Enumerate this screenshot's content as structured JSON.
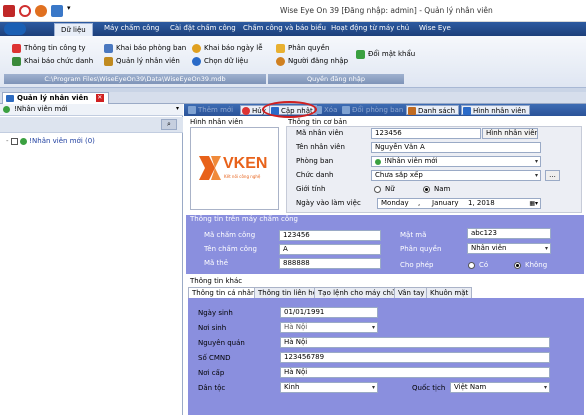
{
  "window": {
    "title": "Wise Eye On 39 [Đăng nhập: admin] - Quản lý nhân viên"
  },
  "menu": [
    {
      "label": "Dữ liệu",
      "active": true
    },
    {
      "label": "Máy chấm công"
    },
    {
      "label": "Cài đặt chấm công"
    },
    {
      "label": "Chấm công và báo biểu"
    },
    {
      "label": "Hoạt động từ máy chủ"
    },
    {
      "label": "Wise Eye"
    }
  ],
  "ribbon": {
    "company_info": "Thông tin công ty",
    "department": "Khai báo phòng ban",
    "holiday": "Khai báo ngày lễ",
    "position": "Khai báo chức danh",
    "staff": "Quản lý nhân viên",
    "select_data": "Chọn dữ liệu",
    "permission": "Phân quyền",
    "login_user": "Người đăng nhập",
    "change_password": "Đổi mật khẩu",
    "path_group": "C:\\Program Files\\WiseEyeOn39\\Data\\WiseEyeOn39.mdb",
    "login_group": "Quyền đăng nhập"
  },
  "doc_tab": {
    "label": "Quản lý nhân viên"
  },
  "left": {
    "header": "!Nhân viên mới",
    "tree_item": "!Nhân viên mới (0)"
  },
  "toolbar": {
    "add": "Thêm mới",
    "cancel": "Hủy",
    "update": "Cập nhật",
    "delete": "Xóa",
    "change_dept": "Đổi phòng ban",
    "list": "Danh sách",
    "photo": "Hình nhân viên"
  },
  "basic": {
    "photo_title": "Hình nhân viên",
    "title": "Thông tin cơ bản",
    "logo_text": "VKEN",
    "logo_sub": "Kết nối công nghệ",
    "emp_id_label": "Mã nhân viên",
    "emp_id": "123456",
    "photo_btn": "Hình nhân viên",
    "name_label": "Tên nhân viên",
    "name": "Nguyễn Văn A",
    "dept_label": "Phòng ban",
    "dept": "!Nhân viên mới",
    "position_label": "Chức danh",
    "position": "Chưa sắp xếp",
    "more_btn": "...",
    "gender_label": "Giới tính",
    "female": "Nữ",
    "male": "Nam",
    "date_label": "Ngày vào làm việc",
    "date_weekday": "Monday",
    "date_sep": ",",
    "date_month": "January",
    "date_day": "1, 2018"
  },
  "machine": {
    "title": "Thông tin trên máy chấm công",
    "att_id_label": "Mã chấm công",
    "att_id": "123456",
    "att_name_label": "Tên chấm công",
    "att_name": "A",
    "card_label": "Mã thẻ",
    "card": "888888",
    "password_label": "Mật mã",
    "password": "abc123",
    "role_label": "Phân quyền",
    "role": "Nhân viên",
    "allow_label": "Cho phép",
    "yes": "Có",
    "no": "Không"
  },
  "other": {
    "title": "Thông tin khác",
    "tabs": [
      "Thông tin cá nhân",
      "Thông tin liên hệ",
      "Tạo lệnh cho máy chủ",
      "Vân tay",
      "Khuôn mặt"
    ],
    "dob_label": "Ngày sinh",
    "dob": "01/01/1991",
    "pob_label": "Nơi sinh",
    "pob": "Hà Nội",
    "origin_label": "Nguyên quán",
    "origin": "Hà Nội",
    "id_label": "Số CMND",
    "id_no": "123456789",
    "issue_label": "Nơi cấp",
    "issue": "Hà Nội",
    "ethnic_label": "Dân tộc",
    "ethnic": "Kinh",
    "nation_label": "Quốc tịch",
    "nation": "Việt Nam"
  },
  "colors": {
    "accent": "#2b5398",
    "section_blue": "#8a8fde",
    "highlight": "#d02020",
    "logo_orange": "#e8621a"
  }
}
